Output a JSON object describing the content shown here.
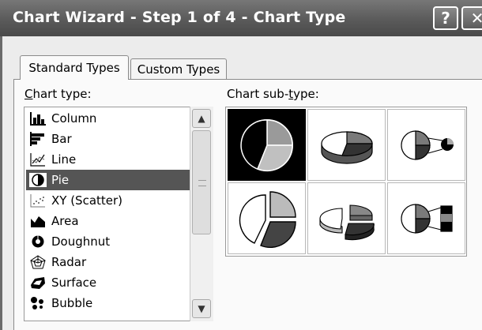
{
  "window": {
    "title": "Chart Wizard - Step 1 of 4 - Chart Type",
    "help_glyph": "?",
    "close_glyph": "✕"
  },
  "tabs": [
    {
      "label": "Standard Types",
      "selected": true
    },
    {
      "label": "Custom Types",
      "selected": false
    }
  ],
  "chart_type": {
    "label_prefix": "C",
    "label_rest": "hart type:",
    "selected": "Pie",
    "items": [
      {
        "label": "Column",
        "icon": "column-chart-icon"
      },
      {
        "label": "Bar",
        "icon": "bar-chart-icon"
      },
      {
        "label": "Line",
        "icon": "line-chart-icon"
      },
      {
        "label": "Pie",
        "icon": "pie-chart-icon"
      },
      {
        "label": "XY (Scatter)",
        "icon": "scatter-chart-icon"
      },
      {
        "label": "Area",
        "icon": "area-chart-icon"
      },
      {
        "label": "Doughnut",
        "icon": "doughnut-chart-icon"
      },
      {
        "label": "Radar",
        "icon": "radar-chart-icon"
      },
      {
        "label": "Surface",
        "icon": "surface-chart-icon"
      },
      {
        "label": "Bubble",
        "icon": "bubble-chart-icon"
      }
    ]
  },
  "sub_type": {
    "label_before": "Chart sub-",
    "label_underlined": "t",
    "label_after": "ype:",
    "items": [
      {
        "icon": "pie-icon",
        "selected": true
      },
      {
        "icon": "pie-3d-icon",
        "selected": false
      },
      {
        "icon": "pie-of-pie-icon",
        "selected": false
      },
      {
        "icon": "exploded-pie-icon",
        "selected": false
      },
      {
        "icon": "exploded-pie-3d-icon",
        "selected": false
      },
      {
        "icon": "bar-of-pie-icon",
        "selected": false
      }
    ]
  }
}
